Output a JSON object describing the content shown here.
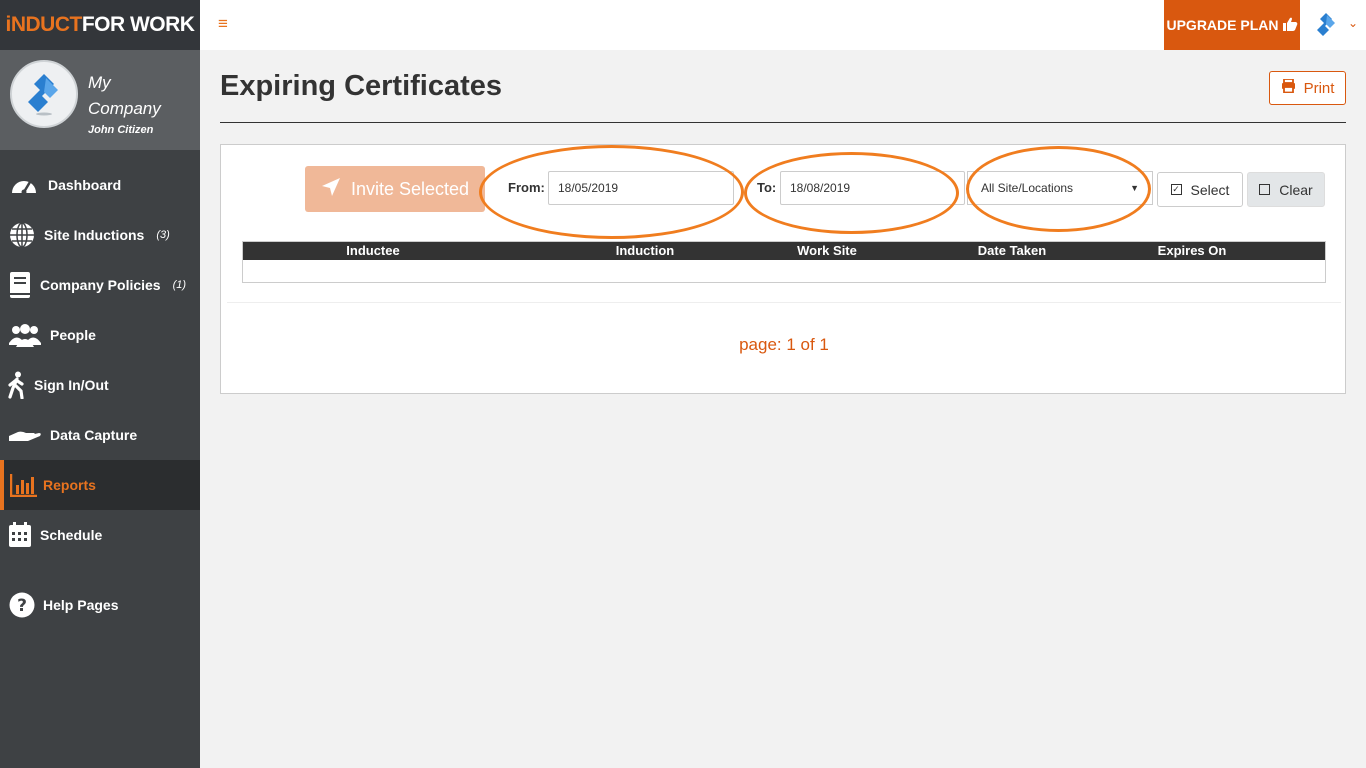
{
  "brand": {
    "accent": "iNDUCT",
    "rest": "FOR WORK"
  },
  "profile": {
    "company": "My Company",
    "user": "John Citizen"
  },
  "nav": [
    {
      "label": "Dashboard",
      "icon": "gauge-icon",
      "count": ""
    },
    {
      "label": "Site Inductions",
      "icon": "globe-icon",
      "count": "(3)"
    },
    {
      "label": "Company Policies",
      "icon": "book-icon",
      "count": "(1)"
    },
    {
      "label": "People",
      "icon": "people-icon",
      "count": ""
    },
    {
      "label": "Sign In/Out",
      "icon": "walking-person-icon",
      "count": ""
    },
    {
      "label": "Data Capture",
      "icon": "hand-icon",
      "count": ""
    },
    {
      "label": "Reports",
      "icon": "bar-chart-icon",
      "count": "",
      "active": true
    },
    {
      "label": "Schedule",
      "icon": "calendar-icon",
      "count": ""
    },
    {
      "label": "Help Pages",
      "icon": "question-circle-icon",
      "count": ""
    }
  ],
  "topbar": {
    "hamburger": "≡",
    "upgrade": "UPGRADE PLAN",
    "upgrade_icon": "thumbs-up-icon",
    "caret": "⌄"
  },
  "page": {
    "title": "Expiring Certificates",
    "print": "Print"
  },
  "filters": {
    "invite": "Invite Selected",
    "from_label": "From:",
    "from_value": "18/05/2019",
    "to_label": "To:",
    "to_value": "18/08/2019",
    "site": "All Site/Locations",
    "select": "Select",
    "clear": "Clear"
  },
  "table": {
    "columns": [
      "Inductee",
      "Induction",
      "Work Site",
      "Date Taken",
      "Expires On"
    ],
    "rows": []
  },
  "pager": "page: 1 of 1",
  "colors": {
    "accent": "#e8731f",
    "upgrade": "#d9580f",
    "sidebar": "#3e4144",
    "highlight_oval": "#f07d1f"
  }
}
